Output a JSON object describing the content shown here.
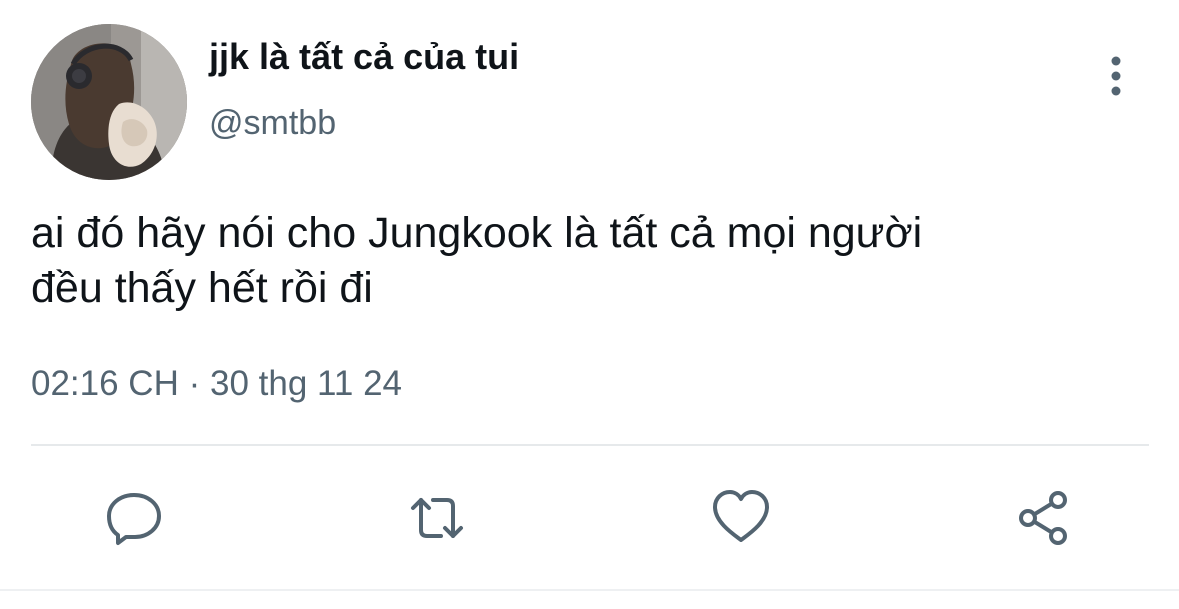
{
  "tweet": {
    "display_name": "jjk là tất cả của tui",
    "handle": "@smtbb",
    "text_lines": [
      "ai đó hãy nói cho Jungkook là tất cả mọi người",
      "đều thấy hết rồi đi"
    ],
    "time": "02:16 CH",
    "separator": " · ",
    "date": "30 thg 11 24"
  },
  "icons": {
    "more": "more-vertical-icon",
    "reply": "reply-icon",
    "retweet": "retweet-icon",
    "like": "heart-icon",
    "share": "share-icon"
  },
  "colors": {
    "text": "#0f1419",
    "secondary": "#536471",
    "divider": "#e6e9eb",
    "background": "#ffffff"
  }
}
